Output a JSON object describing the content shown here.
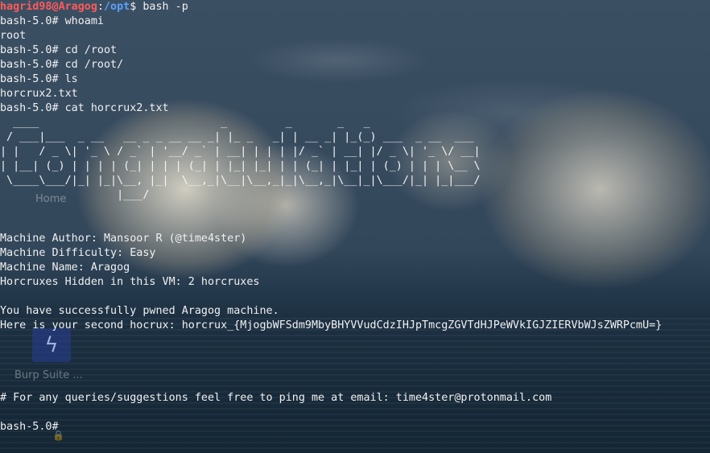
{
  "desktop": {
    "home_label": "Home",
    "burp_label": "Burp Suite ..."
  },
  "prompt": {
    "user": "hagrid98",
    "host": "Aragog",
    "path": "/opt",
    "command": "bash -p"
  },
  "terminal": {
    "lines_before": [
      "bash-5.0# whoami",
      "root",
      "bash-5.0# cd /root",
      "bash-5.0# cd /root/",
      "bash-5.0# ls",
      "horcrux2.txt",
      "bash-5.0# cat horcrux2.txt"
    ],
    "banner": [
      "  ____                            _         _       _   _             ",
      " / ___|___  _ __   __ _ _ __ __ _| |_ _   _| | __ _| |_(_) ___  _ __  ___",
      "| |   / _ \\| '_ \\ / _` | '__/ _` | __| | | | |/ _` | __| |/ _ \\| '_ \\/ __|",
      "| |__| (_) | | | | (_| | | | (_| | |_| |_| | | (_| | |_| | (_) | | | \\__ \\",
      " \\____\\___/|_| |_|\\__, |_|  \\__,_|\\__|\\__,_|_|\\__,_|\\__|_|\\___/|_| |_|___/",
      "                  |___/                                                    "
    ],
    "lines_after": [
      "",
      "",
      "Machine Author: Mansoor R (@time4ster)",
      "Machine Difficulty: Easy",
      "Machine Name: Aragog",
      "Horcruxes Hidden in this VM: 2 horcruxes",
      "",
      "You have successfully pwned Aragog machine.",
      "Here is your second hocrux: horcrux_{MjogbWFSdm9MbyBHYVVudCdzIHJpTmcgZGVTdHJPeWVkIGJZIERVbWJsZWRPcmU=}",
      "",
      "",
      "",
      "",
      "# For any queries/suggestions feel free to ping me at email: time4ster@protonmail.com",
      "",
      "bash-5.0# "
    ]
  }
}
